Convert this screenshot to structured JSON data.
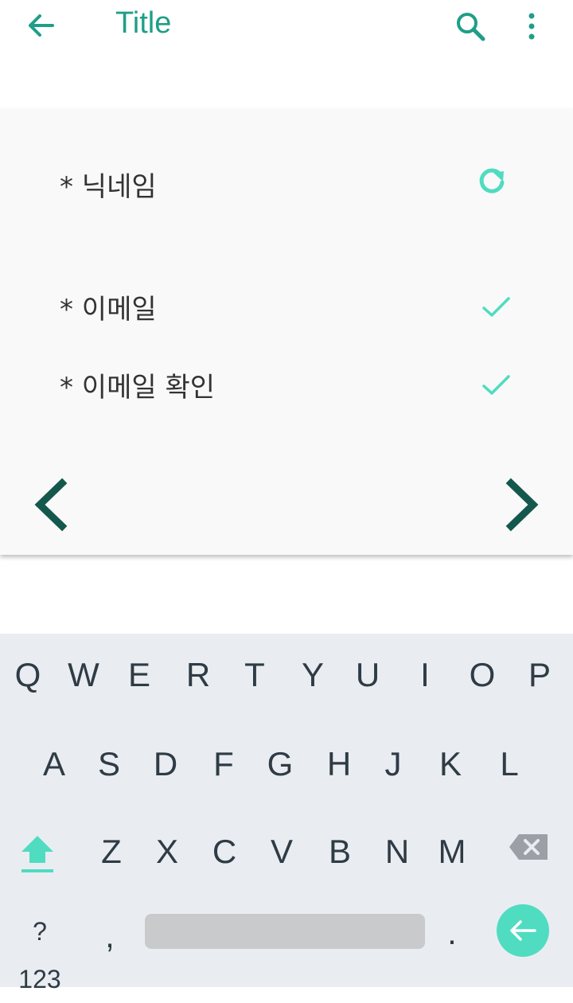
{
  "appbar": {
    "title": "Title",
    "back_icon": "arrow-left-icon",
    "search_icon": "search-icon",
    "more_icon": "more-vertical-icon",
    "accent": "#1f9e88"
  },
  "form": {
    "fields": [
      {
        "label": "* 닉네임",
        "status_icon": "refresh-icon"
      },
      {
        "label": "* 이메일",
        "status_icon": "check-icon"
      },
      {
        "label": "* 이메일 확인",
        "status_icon": "check-icon"
      }
    ],
    "status_color": "#4fdcc1",
    "nav_color": "#14584d"
  },
  "keyboard": {
    "row1": [
      "Q",
      "W",
      "E",
      "R",
      "T",
      "Y",
      "U",
      "I",
      "O",
      "P"
    ],
    "row2": [
      "A",
      "S",
      "D",
      "F",
      "G",
      "H",
      "J",
      "K",
      "L"
    ],
    "row3": [
      "Z",
      "X",
      "C",
      "V",
      "B",
      "N",
      "M"
    ],
    "symbols_label": "?123",
    "comma": ",",
    "period": ".",
    "shift_icon": "shift-arrow-up-icon",
    "backspace_icon": "backspace-icon",
    "enter_icon": "arrow-left-icon",
    "enter_color": "#4fdcc1"
  }
}
